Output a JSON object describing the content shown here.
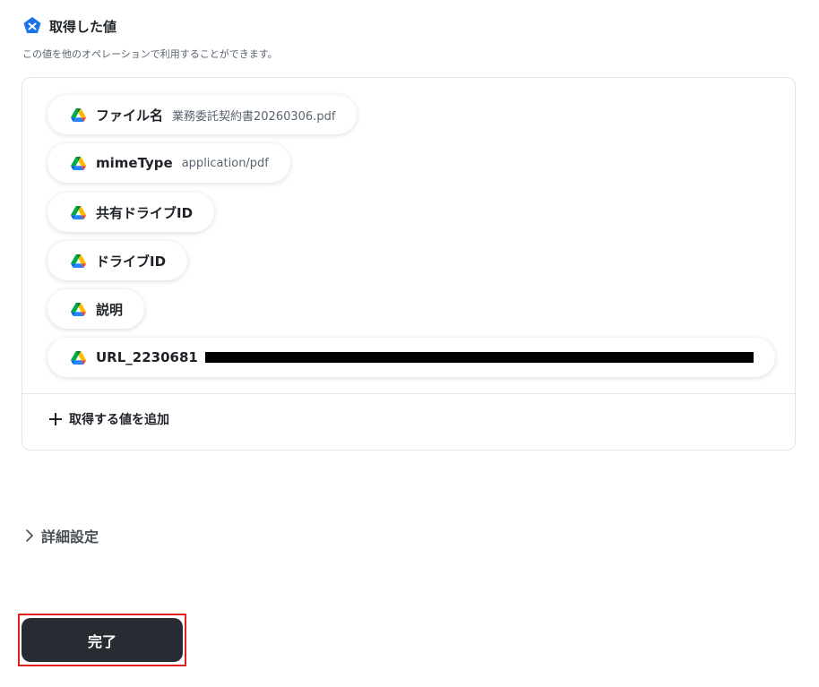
{
  "header": {
    "title": "取得した値",
    "subtitle": "この値を他のオペレーションで利用することができます。"
  },
  "values": [
    {
      "label": "ファイル名",
      "value": "業務委託契約書20260306.pdf",
      "icon": "google-drive-icon"
    },
    {
      "label": "mimeType",
      "value": "application/pdf",
      "icon": "google-drive-icon"
    },
    {
      "label": "共有ドライブID",
      "value": "",
      "icon": "google-drive-icon"
    },
    {
      "label": "ドライブID",
      "value": "",
      "icon": "google-drive-icon"
    },
    {
      "label": "説明",
      "value": "",
      "icon": "google-drive-icon"
    },
    {
      "label": "URL_2230681",
      "value": "",
      "redacted": true,
      "icon": "google-drive-icon"
    }
  ],
  "add_value_label": "取得する値を追加",
  "advanced_settings_label": "詳細設定",
  "done_button_label": "完了",
  "colors": {
    "button_bg": "#272c33",
    "highlight_outline": "#e02020",
    "header_icon": "#1a73e8"
  }
}
